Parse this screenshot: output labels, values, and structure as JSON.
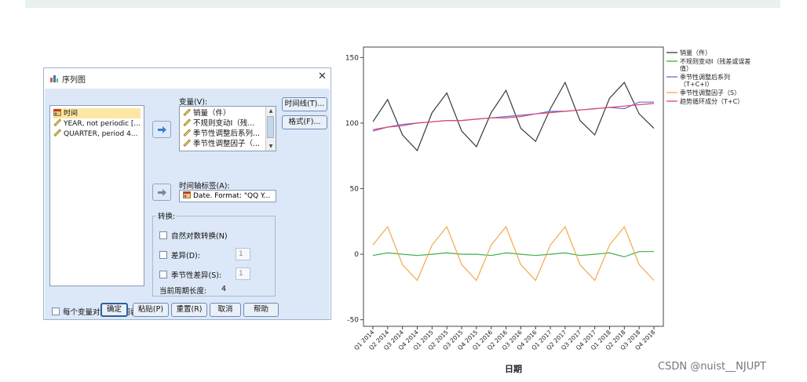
{
  "dialog": {
    "title": "序列图",
    "close_glyph": "✕",
    "source_items": [
      {
        "label": "时间",
        "icon": "date-variable-icon",
        "selected": true
      },
      {
        "label": "YEAR, not periodic [...",
        "icon": "scale-ruler-icon",
        "selected": false
      },
      {
        "label": "QUARTER, period 4...",
        "icon": "scale-ruler-icon",
        "selected": false
      }
    ],
    "variables_label": "变量(V):",
    "variables": [
      "销量（件）",
      "不规则变动I（残...",
      "季节性调整后系列...",
      "季节性调整因子（..."
    ],
    "time_line_button": "时间线(T)...",
    "format_button": "格式(F)...",
    "time_axis_label": "时间轴标签(A):",
    "time_axis_value": "Date.  Format: \"QQ Y...",
    "transform": {
      "legend": "转换:",
      "natural_log": "自然对数转换(N)",
      "difference": "差异(D):",
      "difference_value": "1",
      "seasonal_difference": "季节性差异(S):",
      "seasonal_difference_value": "1",
      "current_period_label": "当前周期长度:",
      "current_period_value": "4"
    },
    "one_chart_per_variable": "每个变量对应一个图表(O)",
    "buttons": {
      "ok": "确定",
      "paste": "粘贴(P)",
      "reset": "重置(R)",
      "cancel": "取消",
      "help": "帮助"
    }
  },
  "chart_data": {
    "type": "line",
    "xlabel": "日期",
    "ylabel": "",
    "ylim": [
      -55,
      158
    ],
    "yticks": [
      -50,
      0,
      50,
      100,
      150
    ],
    "categories": [
      "Q1 2014",
      "Q2 2014",
      "Q3 2014",
      "Q4 2014",
      "Q1 2015",
      "Q2 2015",
      "Q3 2015",
      "Q4 2015",
      "Q1 2016",
      "Q2 2016",
      "Q3 2016",
      "Q4 2016",
      "Q1 2017",
      "Q2 2017",
      "Q3 2017",
      "Q4 2017",
      "Q1 2018",
      "Q2 2018",
      "Q3 2018",
      "Q4 2018"
    ],
    "legend_position": "right",
    "series": [
      {
        "name": "销量（件）",
        "color": "#3a3a3a",
        "values": [
          101,
          118,
          91,
          79,
          108,
          123,
          94,
          82,
          108,
          125,
          96,
          86,
          111,
          131,
          102,
          91,
          119,
          131,
          107,
          96
        ]
      },
      {
        "name": "不规则变动I（残差或误差值）",
        "color": "#3cb04a",
        "values": [
          -1,
          1,
          0,
          -1,
          0,
          1,
          0,
          0,
          -1,
          1,
          0,
          -1,
          0,
          1,
          -1,
          0,
          1,
          -2,
          2,
          2
        ]
      },
      {
        "name": "季节性调整后系列（T+C+I）",
        "color": "#6a6ad8",
        "values": [
          94,
          97,
          99,
          100,
          101,
          102,
          102,
          103,
          104,
          105,
          106,
          107,
          109,
          109,
          110,
          111,
          112,
          111,
          116,
          116
        ]
      },
      {
        "name": "季节性调整因子（S）",
        "color": "#f3a94a",
        "values": [
          7,
          21,
          -8,
          -20,
          7,
          21,
          -8,
          -20,
          7,
          21,
          -8,
          -20,
          7,
          21,
          -8,
          -20,
          7,
          21,
          -8,
          -20
        ]
      },
      {
        "name": "趋势循环成分（T+C）",
        "color": "#e2456c",
        "values": [
          95,
          97,
          98,
          100,
          101,
          102,
          102,
          103,
          104,
          104,
          105,
          107,
          108,
          109,
          110,
          111,
          112,
          113,
          114,
          115
        ]
      }
    ],
    "legend_lines": [
      [
        "销量（件）"
      ],
      [
        "不规则变动I（残差或误差",
        "值）"
      ],
      [
        "季节性调整后系列",
        "（T+C+I）"
      ],
      [
        "季节性调整因子（S）"
      ],
      [
        "趋势循环成分（T+C）"
      ]
    ]
  },
  "watermark": "CSDN @nuist__NJUPT"
}
